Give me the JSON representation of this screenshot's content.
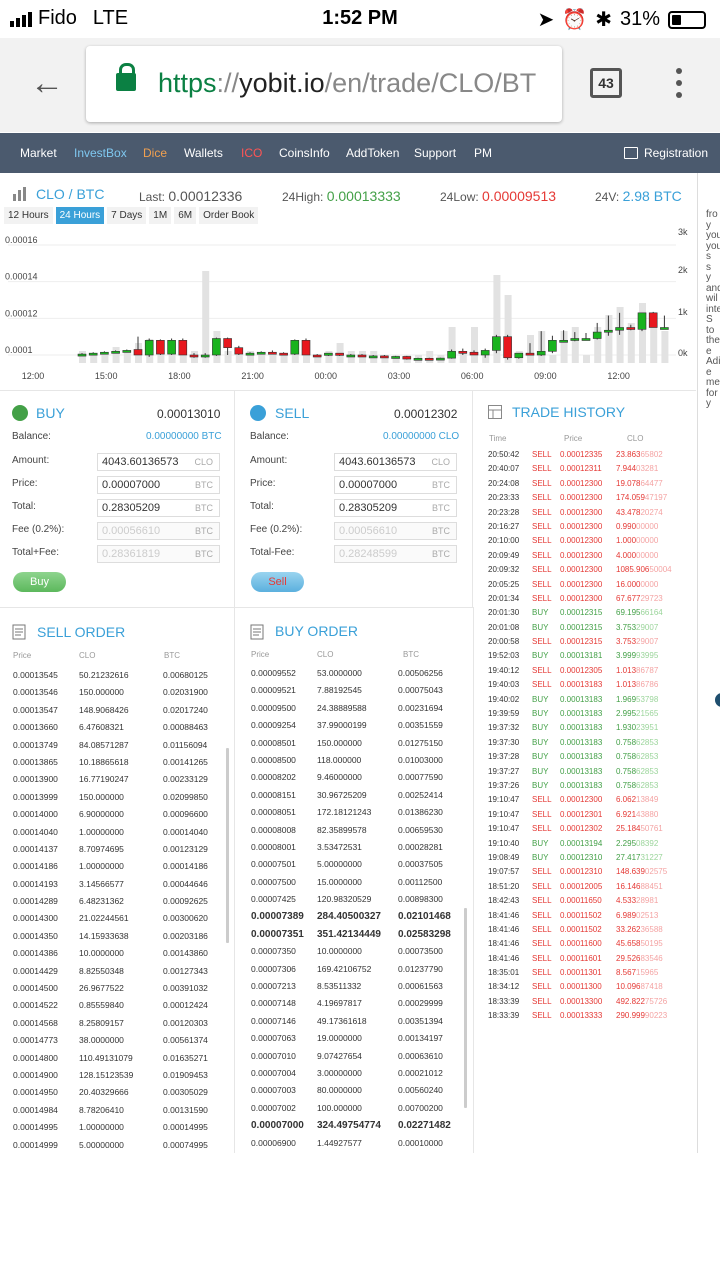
{
  "status": {
    "carrier": "Fido",
    "network": "LTE",
    "time": "1:52 PM",
    "battery": "31%"
  },
  "browser": {
    "url_scheme": "https",
    "url_sep": "://",
    "url_host": "yobit.io",
    "url_path": "/en/trade/CLO/BT",
    "tab_count": "43"
  },
  "nav": {
    "items": [
      "Market",
      "InvestBox",
      "Dice",
      "Wallets",
      "ICO",
      "CoinsInfo",
      "AddToken",
      "Support",
      "PM"
    ],
    "colors": [
      "#ffffff",
      "#7fc8f0",
      "#f0a050",
      "#ffffff",
      "#ff5555",
      "#ffffff",
      "#ffffff",
      "#ffffff",
      "#ffffff"
    ],
    "registration": "Registration"
  },
  "ticker": {
    "pair": "CLO / BTC",
    "last_label": "Last:",
    "last": "0.00012336",
    "high_label": "24High:",
    "high": "0.00013333",
    "low_label": "24Low:",
    "low": "0.00009513",
    "vol_label": "24V:",
    "vol": "2.98 BTC"
  },
  "periods": [
    "12 Hours",
    "24 Hours",
    "7 Days",
    "1M",
    "6M",
    "Order Book"
  ],
  "chart_data": {
    "type": "candlestick",
    "x_ticks": [
      "12:00",
      "15:00",
      "18:00",
      "21:00",
      "00:00",
      "03:00",
      "06:00",
      "09:00",
      "12:00"
    ],
    "y_ticks_left": [
      "0.00016",
      "0.00014",
      "0.00012",
      "0.0001"
    ],
    "y_ticks_right": [
      "3k",
      "2k",
      "1k",
      "0k"
    ],
    "candles": [
      [
        0.0001,
        0.000101,
        9.95e-05,
        0.0001005,
        0.3
      ],
      [
        0.0001005,
        0.0001015,
        0.0001,
        0.000101,
        0.2
      ],
      [
        0.000101,
        0.000102,
        0.0001005,
        0.0001015,
        0.2
      ],
      [
        0.0001015,
        0.0001025,
        0.000101,
        0.000102,
        0.4
      ],
      [
        0.000102,
        0.000103,
        0.0001015,
        0.0001025,
        0.3
      ],
      [
        0.000103,
        0.00011,
        0.0001,
        0.0001,
        0.5
      ],
      [
        0.0001,
        0.000109,
        9.9e-05,
        0.000108,
        0.6
      ],
      [
        0.000108,
        0.0001085,
        0.0001,
        0.0001005,
        0.4
      ],
      [
        0.0001005,
        0.000109,
        0.0001,
        0.000108,
        0.4
      ],
      [
        0.000108,
        0.000109,
        0.0001,
        0.0001,
        0.3
      ],
      [
        0.0001,
        0.000101,
        9.85e-05,
        9.95e-05,
        0.3
      ],
      [
        9.95e-05,
        0.000101,
        9.85e-05,
        0.0001,
        2.3
      ],
      [
        0.0001,
        0.0001095,
        9.95e-05,
        0.000109,
        0.8
      ],
      [
        0.000109,
        0.0001095,
        0.0001,
        0.000104,
        0.3
      ],
      [
        0.000104,
        0.000105,
        0.0001,
        0.0001005,
        0.2
      ],
      [
        0.0001005,
        0.0001015,
        0.0001,
        0.000101,
        0.3
      ],
      [
        0.000101,
        0.000102,
        0.0001005,
        0.0001015,
        0.2
      ],
      [
        0.0001015,
        0.0001025,
        0.0001005,
        0.000101,
        0.2
      ],
      [
        0.000101,
        0.0001015,
        0.0001,
        0.0001005,
        0.2
      ],
      [
        0.0001005,
        0.0001085,
        0.0001,
        0.000108,
        0.3
      ],
      [
        0.000108,
        0.000109,
        0.0001,
        0.0001,
        0.2
      ],
      [
        0.0001,
        0.0001005,
        9.95e-05,
        9.98e-05,
        0.2
      ],
      [
        9.98e-05,
        0.000101,
        9.95e-05,
        0.000101,
        0.3
      ],
      [
        0.000101,
        0.000101,
        9.95e-05,
        9.98e-05,
        0.5
      ],
      [
        9.98e-05,
        0.0001005,
        9.95e-05,
        0.0001,
        0.3
      ],
      [
        0.0001,
        0.0001005,
        9.95e-05,
        9.95e-05,
        0.3
      ],
      [
        9.95e-05,
        0.0001,
        9.9e-05,
        9.95e-05,
        0.3
      ],
      [
        9.95e-05,
        0.0001,
        9.9e-05,
        9.9e-05,
        0.2
      ],
      [
        9.9e-05,
        9.95e-05,
        9.85e-05,
        9.92e-05,
        0.2
      ],
      [
        9.92e-05,
        9.95e-05,
        9.75e-05,
        9.78e-05,
        0.2
      ],
      [
        9.78e-05,
        9.85e-05,
        9.75e-05,
        9.82e-05,
        0.2
      ],
      [
        9.82e-05,
        9.85e-05,
        9.75e-05,
        9.8e-05,
        0.3
      ],
      [
        9.8e-05,
        9.85e-05,
        9.75e-05,
        9.83e-05,
        0.2
      ],
      [
        9.83e-05,
        0.000103,
        9.8e-05,
        0.000102,
        0.9
      ],
      [
        0.000102,
        0.0001035,
        0.0001,
        0.0001015,
        0.3
      ],
      [
        0.0001015,
        0.0001025,
        0.0001,
        0.0001,
        0.9
      ],
      [
        0.0001,
        0.0001035,
        9.85e-05,
        0.0001025,
        0.3
      ],
      [
        0.0001025,
        0.000111,
        0.000101,
        0.00011,
        2.2
      ],
      [
        0.00011,
        0.000111,
        9.75e-05,
        9.85e-05,
        1.7
      ],
      [
        9.85e-05,
        0.000101,
        9.8e-05,
        0.000101,
        0.3
      ],
      [
        0.000101,
        0.0001065,
        0.0001,
        0.0001,
        0.7
      ],
      [
        0.0001,
        0.000113,
        9.95e-05,
        0.000102,
        0.8
      ],
      [
        0.000102,
        0.0001105,
        0.000101,
        0.000108,
        0.2
      ],
      [
        0.000108,
        0.0001135,
        0.000107,
        0.000108,
        0.8
      ],
      [
        0.000108,
        0.0001125,
        0.0001075,
        0.000109,
        0.9
      ],
      [
        0.000109,
        0.000112,
        0.000108,
        0.000109,
        0.2
      ],
      [
        0.000109,
        0.0001175,
        0.0001085,
        0.0001125,
        0.9
      ],
      [
        0.0001125,
        0.0001215,
        0.0001105,
        0.0001135,
        1.2
      ],
      [
        0.0001135,
        0.000123,
        0.000111,
        0.000115,
        1.4
      ],
      [
        0.000115,
        0.0001165,
        0.0001135,
        0.000114,
        1.0
      ],
      [
        0.000114,
        0.000122,
        0.000113,
        0.000123,
        1.5
      ],
      [
        0.000123,
        0.0001235,
        0.000115,
        0.000115,
        1.1
      ],
      [
        0.000115,
        0.0001215,
        0.000115,
        0.000115,
        0.8
      ]
    ]
  },
  "buy": {
    "title": "BUY",
    "price": "0.00013010",
    "balance_label": "Balance:",
    "balance": "0.00000000 BTC",
    "amount_label": "Amount:",
    "amount": "4043.60136573",
    "amount_cur": "CLO",
    "price_label": "Price:",
    "price_val": "0.00007000",
    "price_cur": "BTC",
    "total_label": "Total:",
    "total": "0.28305209",
    "total_cur": "BTC",
    "fee_label": "Fee (0.2%):",
    "fee": "0.00056610",
    "fee_cur": "BTC",
    "tf_label": "Total+Fee:",
    "tf": "0.28361819",
    "tf_cur": "BTC",
    "button": "Buy"
  },
  "sell": {
    "title": "SELL",
    "price": "0.00012302",
    "balance_label": "Balance:",
    "balance": "0.00000000 CLO",
    "amount_label": "Amount:",
    "amount": "4043.60136573",
    "amount_cur": "CLO",
    "price_label": "Price:",
    "price_val": "0.00007000",
    "price_cur": "BTC",
    "total_label": "Total:",
    "total": "0.28305209",
    "total_cur": "BTC",
    "fee_label": "Fee (0.2%):",
    "fee": "0.00056610",
    "fee_cur": "BTC",
    "tf_label": "Total-Fee:",
    "tf": "0.28248599",
    "tf_cur": "BTC",
    "button": "Sell"
  },
  "trade_history": {
    "title": "TRADE HISTORY",
    "cols": [
      "Time",
      "Price",
      "CLO"
    ],
    "rows": [
      [
        "20:50:42",
        "SELL",
        "0.00012335",
        "23.863",
        "65802"
      ],
      [
        "20:40:07",
        "SELL",
        "0.00012311",
        "7.944",
        "03281"
      ],
      [
        "20:24:08",
        "SELL",
        "0.00012300",
        "19.078",
        "64477"
      ],
      [
        "20:23:33",
        "SELL",
        "0.00012300",
        "174.059",
        "47197"
      ],
      [
        "20:23:28",
        "SELL",
        "0.00012300",
        "43.478",
        "20274"
      ],
      [
        "20:16:27",
        "SELL",
        "0.00012300",
        "0.990",
        "00000"
      ],
      [
        "20:10:00",
        "SELL",
        "0.00012300",
        "1.000",
        "00000"
      ],
      [
        "20:09:49",
        "SELL",
        "0.00012300",
        "4.000",
        "00000"
      ],
      [
        "20:09:32",
        "SELL",
        "0.00012300",
        "1085.906",
        "50004"
      ],
      [
        "20:05:25",
        "SELL",
        "0.00012300",
        "16.000",
        "0000"
      ],
      [
        "20:01:34",
        "SELL",
        "0.00012300",
        "67.677",
        "29723"
      ],
      [
        "20:01:30",
        "BUY",
        "0.00012315",
        "69.195",
        "66164"
      ],
      [
        "20:01:08",
        "BUY",
        "0.00012315",
        "3.753",
        "29007"
      ],
      [
        "20:00:58",
        "SELL",
        "0.00012315",
        "3.753",
        "29007"
      ],
      [
        "19:52:03",
        "BUY",
        "0.00013181",
        "3.999",
        "93995"
      ],
      [
        "19:40:12",
        "SELL",
        "0.00012305",
        "1.013",
        "86787"
      ],
      [
        "19:40:03",
        "SELL",
        "0.00013183",
        "1.013",
        "86786"
      ],
      [
        "19:40:02",
        "BUY",
        "0.00013183",
        "1.969",
        "53798"
      ],
      [
        "19:39:59",
        "BUY",
        "0.00013183",
        "2.995",
        "21565"
      ],
      [
        "19:37:32",
        "BUY",
        "0.00013183",
        "1.930",
        "23951"
      ],
      [
        "19:37:30",
        "BUY",
        "0.00013183",
        "0.758",
        "62853"
      ],
      [
        "19:37:28",
        "BUY",
        "0.00013183",
        "0.758",
        "62853"
      ],
      [
        "19:37:27",
        "BUY",
        "0.00013183",
        "0.758",
        "62853"
      ],
      [
        "19:37:26",
        "BUY",
        "0.00013183",
        "0.758",
        "62853"
      ],
      [
        "19:10:47",
        "SELL",
        "0.00012300",
        "6.062",
        "13849"
      ],
      [
        "19:10:47",
        "SELL",
        "0.00012301",
        "6.921",
        "43880"
      ],
      [
        "19:10:47",
        "SELL",
        "0.00012302",
        "25.184",
        "50761"
      ],
      [
        "19:10:40",
        "BUY",
        "0.00013194",
        "2.295",
        "08392"
      ],
      [
        "19:08:49",
        "BUY",
        "0.00012310",
        "27.417",
        "31227"
      ],
      [
        "19:07:57",
        "SELL",
        "0.00012310",
        "148.639",
        "02575"
      ],
      [
        "18:51:20",
        "SELL",
        "0.00012005",
        "16.146",
        "88451"
      ],
      [
        "18:42:43",
        "SELL",
        "0.00011650",
        "4.533",
        "28981"
      ],
      [
        "18:41:46",
        "SELL",
        "0.00011502",
        "6.989",
        "02513"
      ],
      [
        "18:41:46",
        "SELL",
        "0.00011502",
        "33.262",
        "36588"
      ],
      [
        "18:41:46",
        "SELL",
        "0.00011600",
        "45.658",
        "50195"
      ],
      [
        "18:41:46",
        "SELL",
        "0.00011601",
        "29.526",
        "83546"
      ],
      [
        "18:35:01",
        "SELL",
        "0.00011301",
        "8.567",
        "15965"
      ],
      [
        "18:34:12",
        "SELL",
        "0.00011300",
        "10.096",
        "87418"
      ],
      [
        "18:33:39",
        "SELL",
        "0.00013300",
        "492.822",
        "75726"
      ],
      [
        "18:33:39",
        "SELL",
        "0.00013333",
        "290.999",
        "90223"
      ]
    ]
  },
  "sell_order": {
    "title": "SELL ORDER",
    "cols": [
      "Price",
      "CLO",
      "BTC"
    ],
    "rows": [
      [
        "0.00013545",
        "50.21232616",
        "0.00680125"
      ],
      [
        "0.00013546",
        "150.000000",
        "0.02031900"
      ],
      [
        "0.00013547",
        "148.9068426",
        "0.02017240"
      ],
      [
        "0.00013660",
        "6.47608321",
        "0.00088463"
      ],
      [
        "0.00013749",
        "84.08571287",
        "0.01156094"
      ],
      [
        "0.00013865",
        "10.18865618",
        "0.00141265"
      ],
      [
        "0.00013900",
        "16.77190247",
        "0.00233129"
      ],
      [
        "0.00013999",
        "150.000000",
        "0.02099850"
      ],
      [
        "0.00014000",
        "6.90000000",
        "0.00096600"
      ],
      [
        "0.00014040",
        "1.00000000",
        "0.00014040"
      ],
      [
        "0.00014137",
        "8.70974695",
        "0.00123129"
      ],
      [
        "0.00014186",
        "1.00000000",
        "0.00014186"
      ],
      [
        "0.00014193",
        "3.14566577",
        "0.00044646"
      ],
      [
        "0.00014289",
        "6.48231362",
        "0.00092625"
      ],
      [
        "0.00014300",
        "21.02244561",
        "0.00300620"
      ],
      [
        "0.00014350",
        "14.15933638",
        "0.00203186"
      ],
      [
        "0.00014386",
        "10.0000000",
        "0.00143860"
      ],
      [
        "0.00014429",
        "8.82550348",
        "0.00127343"
      ],
      [
        "0.00014500",
        "26.9677522",
        "0.00391032"
      ],
      [
        "0.00014522",
        "0.85559840",
        "0.00012424"
      ],
      [
        "0.00014568",
        "8.25809157",
        "0.00120303"
      ],
      [
        "0.00014773",
        "38.0000000",
        "0.00561374"
      ],
      [
        "0.00014800",
        "110.49131079",
        "0.01635271"
      ],
      [
        "0.00014900",
        "128.15123539",
        "0.01909453"
      ],
      [
        "0.00014950",
        "20.40329666",
        "0.00305029"
      ],
      [
        "0.00014984",
        "8.78206410",
        "0.00131590"
      ],
      [
        "0.00014995",
        "1.00000000",
        "0.00014995"
      ],
      [
        "0.00014999",
        "5.00000000",
        "0.00074995"
      ]
    ]
  },
  "buy_order": {
    "title": "BUY ORDER",
    "cols": [
      "Price",
      "CLO",
      "BTC"
    ],
    "rows": [
      [
        "0.00009552",
        "53.0000000",
        "0.00506256"
      ],
      [
        "0.00009521",
        "7.88192545",
        "0.00075043"
      ],
      [
        "0.00009500",
        "24.38889588",
        "0.00231694"
      ],
      [
        "0.00009254",
        "37.99000199",
        "0.00351559"
      ],
      [
        "0.00008501",
        "150.000000",
        "0.01275150"
      ],
      [
        "0.00008500",
        "118.000000",
        "0.01003000"
      ],
      [
        "0.00008202",
        "9.46000000",
        "0.00077590"
      ],
      [
        "0.00008151",
        "30.96725209",
        "0.00252414"
      ],
      [
        "0.00008051",
        "172.18121243",
        "0.01386230"
      ],
      [
        "0.00008008",
        "82.35899578",
        "0.00659530"
      ],
      [
        "0.00008001",
        "3.53472531",
        "0.00028281"
      ],
      [
        "0.00007501",
        "5.00000000",
        "0.00037505"
      ],
      [
        "0.00007500",
        "15.0000000",
        "0.00112500"
      ],
      [
        "0.00007425",
        "120.98320529",
        "0.00898300"
      ],
      [
        "0.00007389",
        "284.40500327",
        "0.02101468"
      ],
      [
        "0.00007351",
        "351.42134449",
        "0.02583298"
      ],
      [
        "0.00007350",
        "10.0000000",
        "0.00073500"
      ],
      [
        "0.00007306",
        "169.42106752",
        "0.01237790"
      ],
      [
        "0.00007213",
        "8.53511332",
        "0.00061563"
      ],
      [
        "0.00007148",
        "4.19697817",
        "0.00029999"
      ],
      [
        "0.00007146",
        "49.17361618",
        "0.00351394"
      ],
      [
        "0.00007063",
        "19.0000000",
        "0.00134197"
      ],
      [
        "0.00007010",
        "9.07427654",
        "0.00063610"
      ],
      [
        "0.00007004",
        "3.00000000",
        "0.00021012"
      ],
      [
        "0.00007003",
        "80.0000000",
        "0.00560240"
      ],
      [
        "0.00007002",
        "100.000000",
        "0.00700200"
      ],
      [
        "0.00007000",
        "324.49754774",
        "0.02271482"
      ],
      [
        "0.00006900",
        "1.44927577",
        "0.00010000"
      ]
    ],
    "bold_rows": [
      14,
      15,
      26
    ]
  },
  "right_panel": {
    "lines": [
      "fro",
      "y",
      "you",
      "you",
      "s",
      "s",
      "y",
      "and",
      "wil",
      "inte",
      "S",
      "to",
      "the",
      "e",
      "Adi",
      "e",
      "me",
      "for",
      "y"
    ]
  }
}
